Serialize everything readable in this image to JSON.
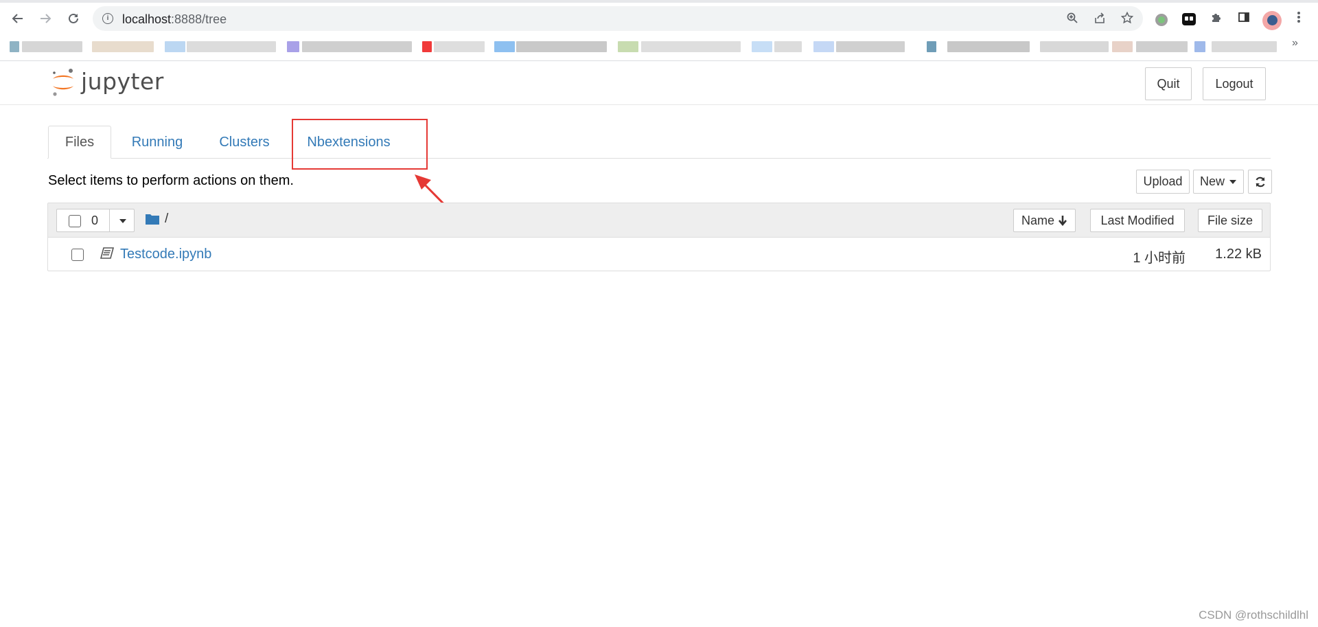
{
  "browser": {
    "url_host": "localhost",
    "url_rest": ":8888/tree",
    "more_bookmarks": "»"
  },
  "header": {
    "logo_text": "jupyter",
    "quit_label": "Quit",
    "logout_label": "Logout"
  },
  "tabs": [
    {
      "label": "Files",
      "active": true
    },
    {
      "label": "Running",
      "active": false
    },
    {
      "label": "Clusters",
      "active": false
    },
    {
      "label": "Nbextensions",
      "active": false
    }
  ],
  "toolbar": {
    "hint": "Select items to perform actions on them.",
    "upload_label": "Upload",
    "new_label": "New"
  },
  "list": {
    "selected_count": "0",
    "path": "/",
    "columns": {
      "name": "Name",
      "last_modified": "Last Modified",
      "file_size": "File size"
    },
    "rows": [
      {
        "name": "Testcode.ipynb",
        "modified": "1 小时前",
        "size": "1.22 kB"
      }
    ]
  },
  "colors": {
    "link": "#337ab7",
    "annotation": "#e53935",
    "jupyter_orange": "#f37726"
  },
  "watermark": "CSDN @rothschildlhl"
}
